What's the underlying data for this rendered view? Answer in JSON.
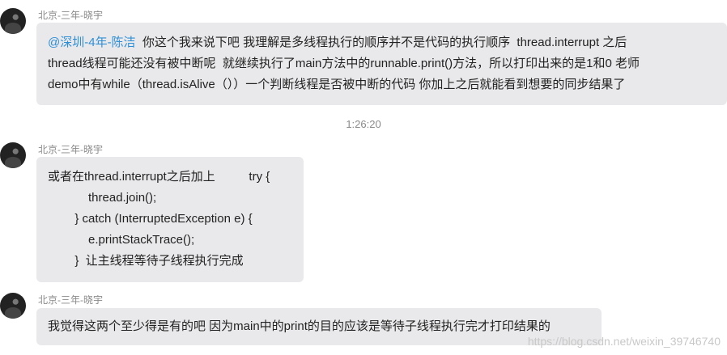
{
  "messages": [
    {
      "sender": "北京-三年-晓宇",
      "mention": "@深圳-4年-陈洁",
      "lines": [
        "你这个我来说下吧 我理解是多线程执行的顺序并不是代码的执行顺序  thread.interrupt 之后",
        "thread线程可能还没有被中断呢  就继续执行了main方法中的runnable.print()方法，所以打印出来的是1和0 老师",
        "demo中有while（thread.isAlive（））一个判断线程是否被中断的代码 你加上之后就能看到想要的同步结果了"
      ]
    },
    {
      "sender": "北京-三年-晓宇",
      "lines": [
        "或者在thread.interrupt之后加上          try {",
        "            thread.join();",
        "        } catch (InterruptedException e) {",
        "            e.printStackTrace();",
        "        }  让主线程等待子线程执行完成"
      ]
    },
    {
      "sender": "北京-三年-晓宇",
      "lines": [
        "我觉得这两个至少得是有的吧 因为main中的print的目的应该是等待子线程执行完才打印结果的"
      ]
    }
  ],
  "timestamp": "1:26:20",
  "watermark": "https://blog.csdn.net/weixin_39746740"
}
